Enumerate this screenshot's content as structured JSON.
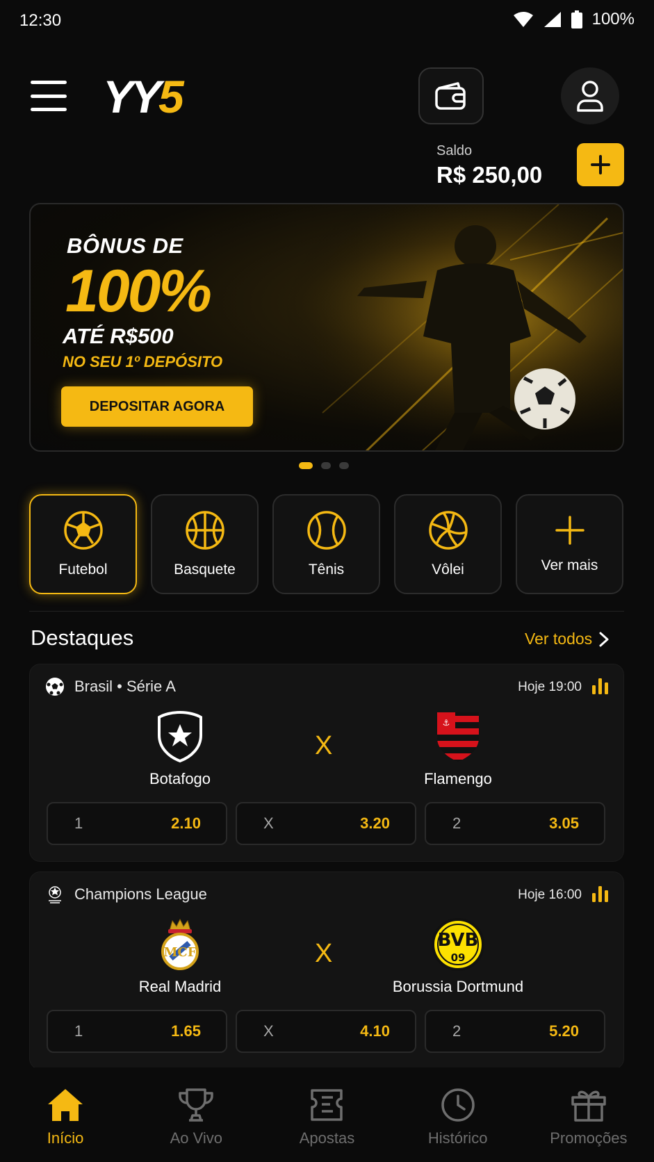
{
  "status": {
    "time": "12:30",
    "battery": "100%"
  },
  "header": {
    "logo_main": "YY",
    "logo_accent": "5"
  },
  "balance": {
    "label": "Saldo",
    "value": "R$ 250,00"
  },
  "banner": {
    "line1": "BÔNUS DE",
    "headline": "100%",
    "line3": "ATÉ R$500",
    "line4": "NO SEU 1º DEPÓSITO",
    "cta": "DEPOSITAR AGORA"
  },
  "sports": [
    {
      "label": "Futebol",
      "icon": "soccer-ball-icon"
    },
    {
      "label": "Basquete",
      "icon": "basketball-icon"
    },
    {
      "label": "Tênis",
      "icon": "tennis-ball-icon"
    },
    {
      "label": "Vôlei",
      "icon": "volleyball-icon"
    },
    {
      "label": "Ver mais",
      "icon": "plus-icon"
    }
  ],
  "highlights": {
    "title": "Destaques",
    "see_all": "Ver todos",
    "matches": [
      {
        "league": "Brasil • Série A",
        "time": "Hoje 19:00",
        "home": "Botafogo",
        "away": "Flamengo",
        "vs": "X",
        "odds": [
          {
            "key": "1",
            "value": "2.10"
          },
          {
            "key": "X",
            "value": "3.20"
          },
          {
            "key": "2",
            "value": "3.05"
          }
        ]
      },
      {
        "league": "Champions League",
        "time": "Hoje 16:00",
        "home": "Real Madrid",
        "away": "Borussia Dortmund",
        "vs": "X",
        "odds": [
          {
            "key": "1",
            "value": "1.65"
          },
          {
            "key": "X",
            "value": "4.10"
          },
          {
            "key": "2",
            "value": "5.20"
          }
        ]
      }
    ]
  },
  "nav": [
    {
      "label": "Início",
      "icon": "home-icon"
    },
    {
      "label": "Ao Vivo",
      "icon": "trophy-icon"
    },
    {
      "label": "Apostas",
      "icon": "ticket-icon"
    },
    {
      "label": "Histórico",
      "icon": "clock-icon"
    },
    {
      "label": "Promoções",
      "icon": "gift-icon"
    }
  ],
  "colors": {
    "accent": "#f5b913",
    "background": "#0b0b0b",
    "card": "#141414"
  }
}
